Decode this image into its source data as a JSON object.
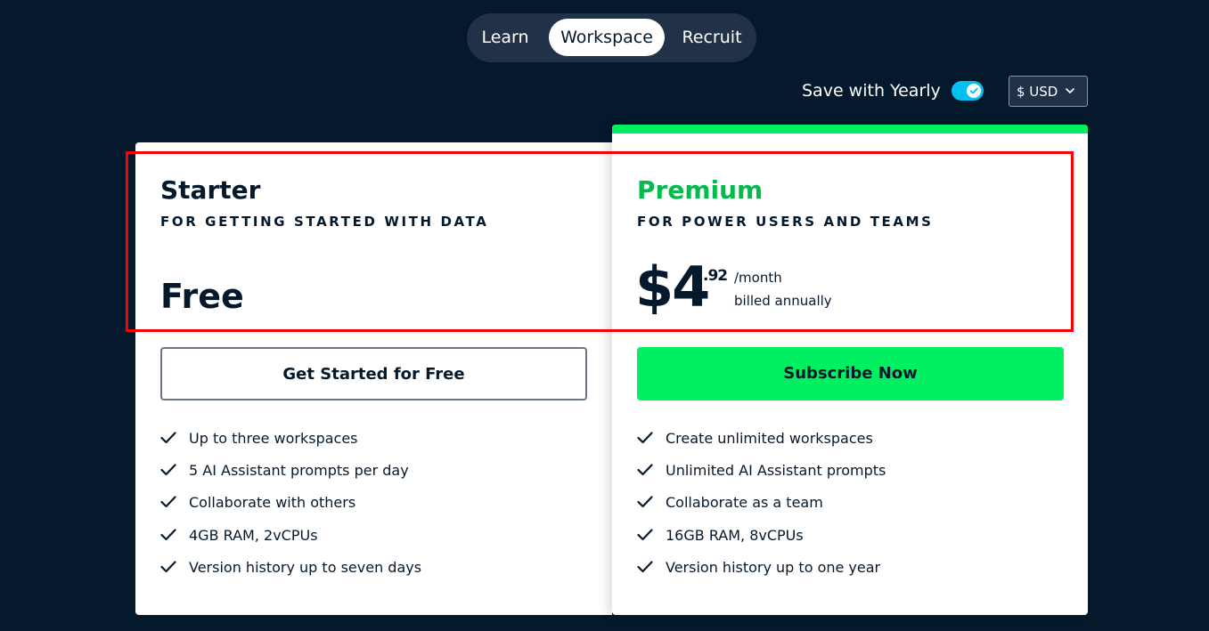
{
  "tabs": [
    {
      "label": "Learn",
      "active": false
    },
    {
      "label": "Workspace",
      "active": true
    },
    {
      "label": "Recruit",
      "active": false
    }
  ],
  "billing": {
    "save_label": "Save with Yearly",
    "yearly_enabled": true,
    "toggle_color": "#03c0f0",
    "currency_label": "$ USD"
  },
  "plans": {
    "starter": {
      "name": "Starter",
      "tagline": "FOR GETTING STARTED WITH DATA",
      "price": "Free",
      "cta": "Get Started for Free",
      "features": [
        "Up to three workspaces",
        "5 AI Assistant prompts per day",
        "Collaborate with others",
        "4GB RAM, 2vCPUs",
        "Version history up to seven days"
      ]
    },
    "premium": {
      "name": "Premium",
      "tagline": "FOR POWER USERS AND TEAMS",
      "price_main": "$4",
      "price_cents": ".92",
      "price_period": "/month",
      "price_billing": "billed annually",
      "cta": "Subscribe Now",
      "accent_color": "#03ef62",
      "name_color": "#03ba4c",
      "features": [
        "Create unlimited workspaces",
        "Unlimited AI Assistant prompts",
        "Collaborate as a team",
        "16GB RAM, 8vCPUs",
        "Version history up to one year"
      ]
    }
  },
  "colors": {
    "background": "#05192d",
    "highlight": "#ff0000"
  }
}
